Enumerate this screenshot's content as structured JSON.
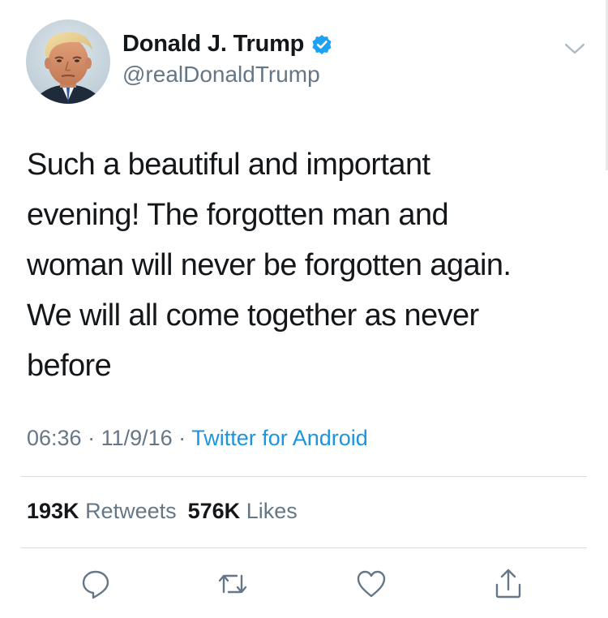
{
  "user": {
    "display_name": "Donald J. Trump",
    "handle": "@realDonaldTrump",
    "verified": true,
    "avatar": "profile-photo"
  },
  "tweet": {
    "text": "Such a beautiful and important\nevening! The forgotten man and\nwoman will never be forgotten again.\nWe will all come together as never\nbefore"
  },
  "meta": {
    "time": "06:36",
    "sep1": " · ",
    "date": "11/9/16",
    "sep2": " · ",
    "source": "Twitter for Android"
  },
  "stats": {
    "retweets_count": "193K",
    "retweets_label": "Retweets",
    "likes_count": "576K",
    "likes_label": "Likes"
  },
  "actions": {
    "icons": [
      "reply-icon",
      "retweet-icon",
      "like-icon",
      "share-icon"
    ]
  },
  "colors": {
    "text": "#14171a",
    "secondary": "#657786",
    "link": "#1b95e0",
    "verified_badge": "#1da1f2",
    "divider": "#d6dbdf"
  }
}
